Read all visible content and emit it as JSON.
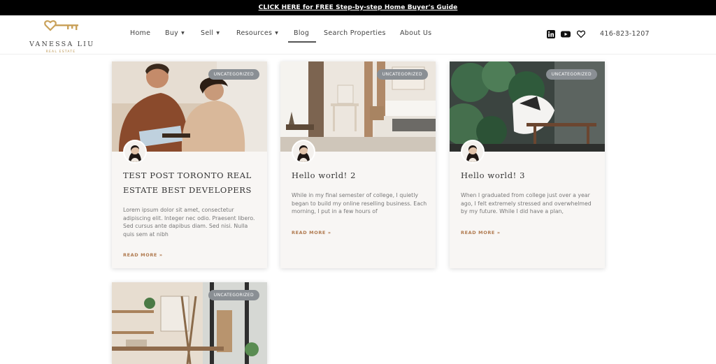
{
  "topbar": {
    "link_text": "CLICK HERE for FREE Step-by-step Home Buyer's Guide"
  },
  "logo": {
    "name": "VANESSA LIU",
    "sub": "REAL ESTATE"
  },
  "nav": {
    "items": [
      {
        "label": "Home"
      },
      {
        "label": "Buy"
      },
      {
        "label": "Sell"
      },
      {
        "label": "Resources"
      },
      {
        "label": "Blog"
      },
      {
        "label": "Search Properties"
      },
      {
        "label": "About Us"
      }
    ]
  },
  "social": {
    "icons": [
      "linkedin-icon",
      "youtube-icon",
      "heart-icon"
    ]
  },
  "contact": {
    "phone": "416-823-1207"
  },
  "colors": {
    "accent": "#b07a4f",
    "badge": "#8a8f94",
    "gold": "#c9a15a"
  },
  "posts": [
    {
      "category": "UNCATEGORIZED",
      "title": "TEST POST  TORONTO REAL ESTATE BEST DEVELOPERS",
      "excerpt": "Lorem ipsum dolor sit amet, consectetur adipiscing elit. Integer nec odio. Praesent libero. Sed cursus ante dapibus diam. Sed nisi. Nulla quis sem at nibh",
      "read_more": "READ MORE »"
    },
    {
      "category": "UNCATEGORIZED",
      "title": "Hello world! 2",
      "excerpt": "While in my final semester of college, I quietly began to build my online reselling business. Each morning, I put in a few hours of",
      "read_more": "READ MORE »"
    },
    {
      "category": "UNCATEGORIZED",
      "title": "Hello world! 3",
      "excerpt": "When I graduated from college just over a year ago, I felt extremely stressed and overwhelmed by my future. While I did have a plan,",
      "read_more": "READ MORE »"
    },
    {
      "category": "UNCATEGORIZED"
    }
  ]
}
